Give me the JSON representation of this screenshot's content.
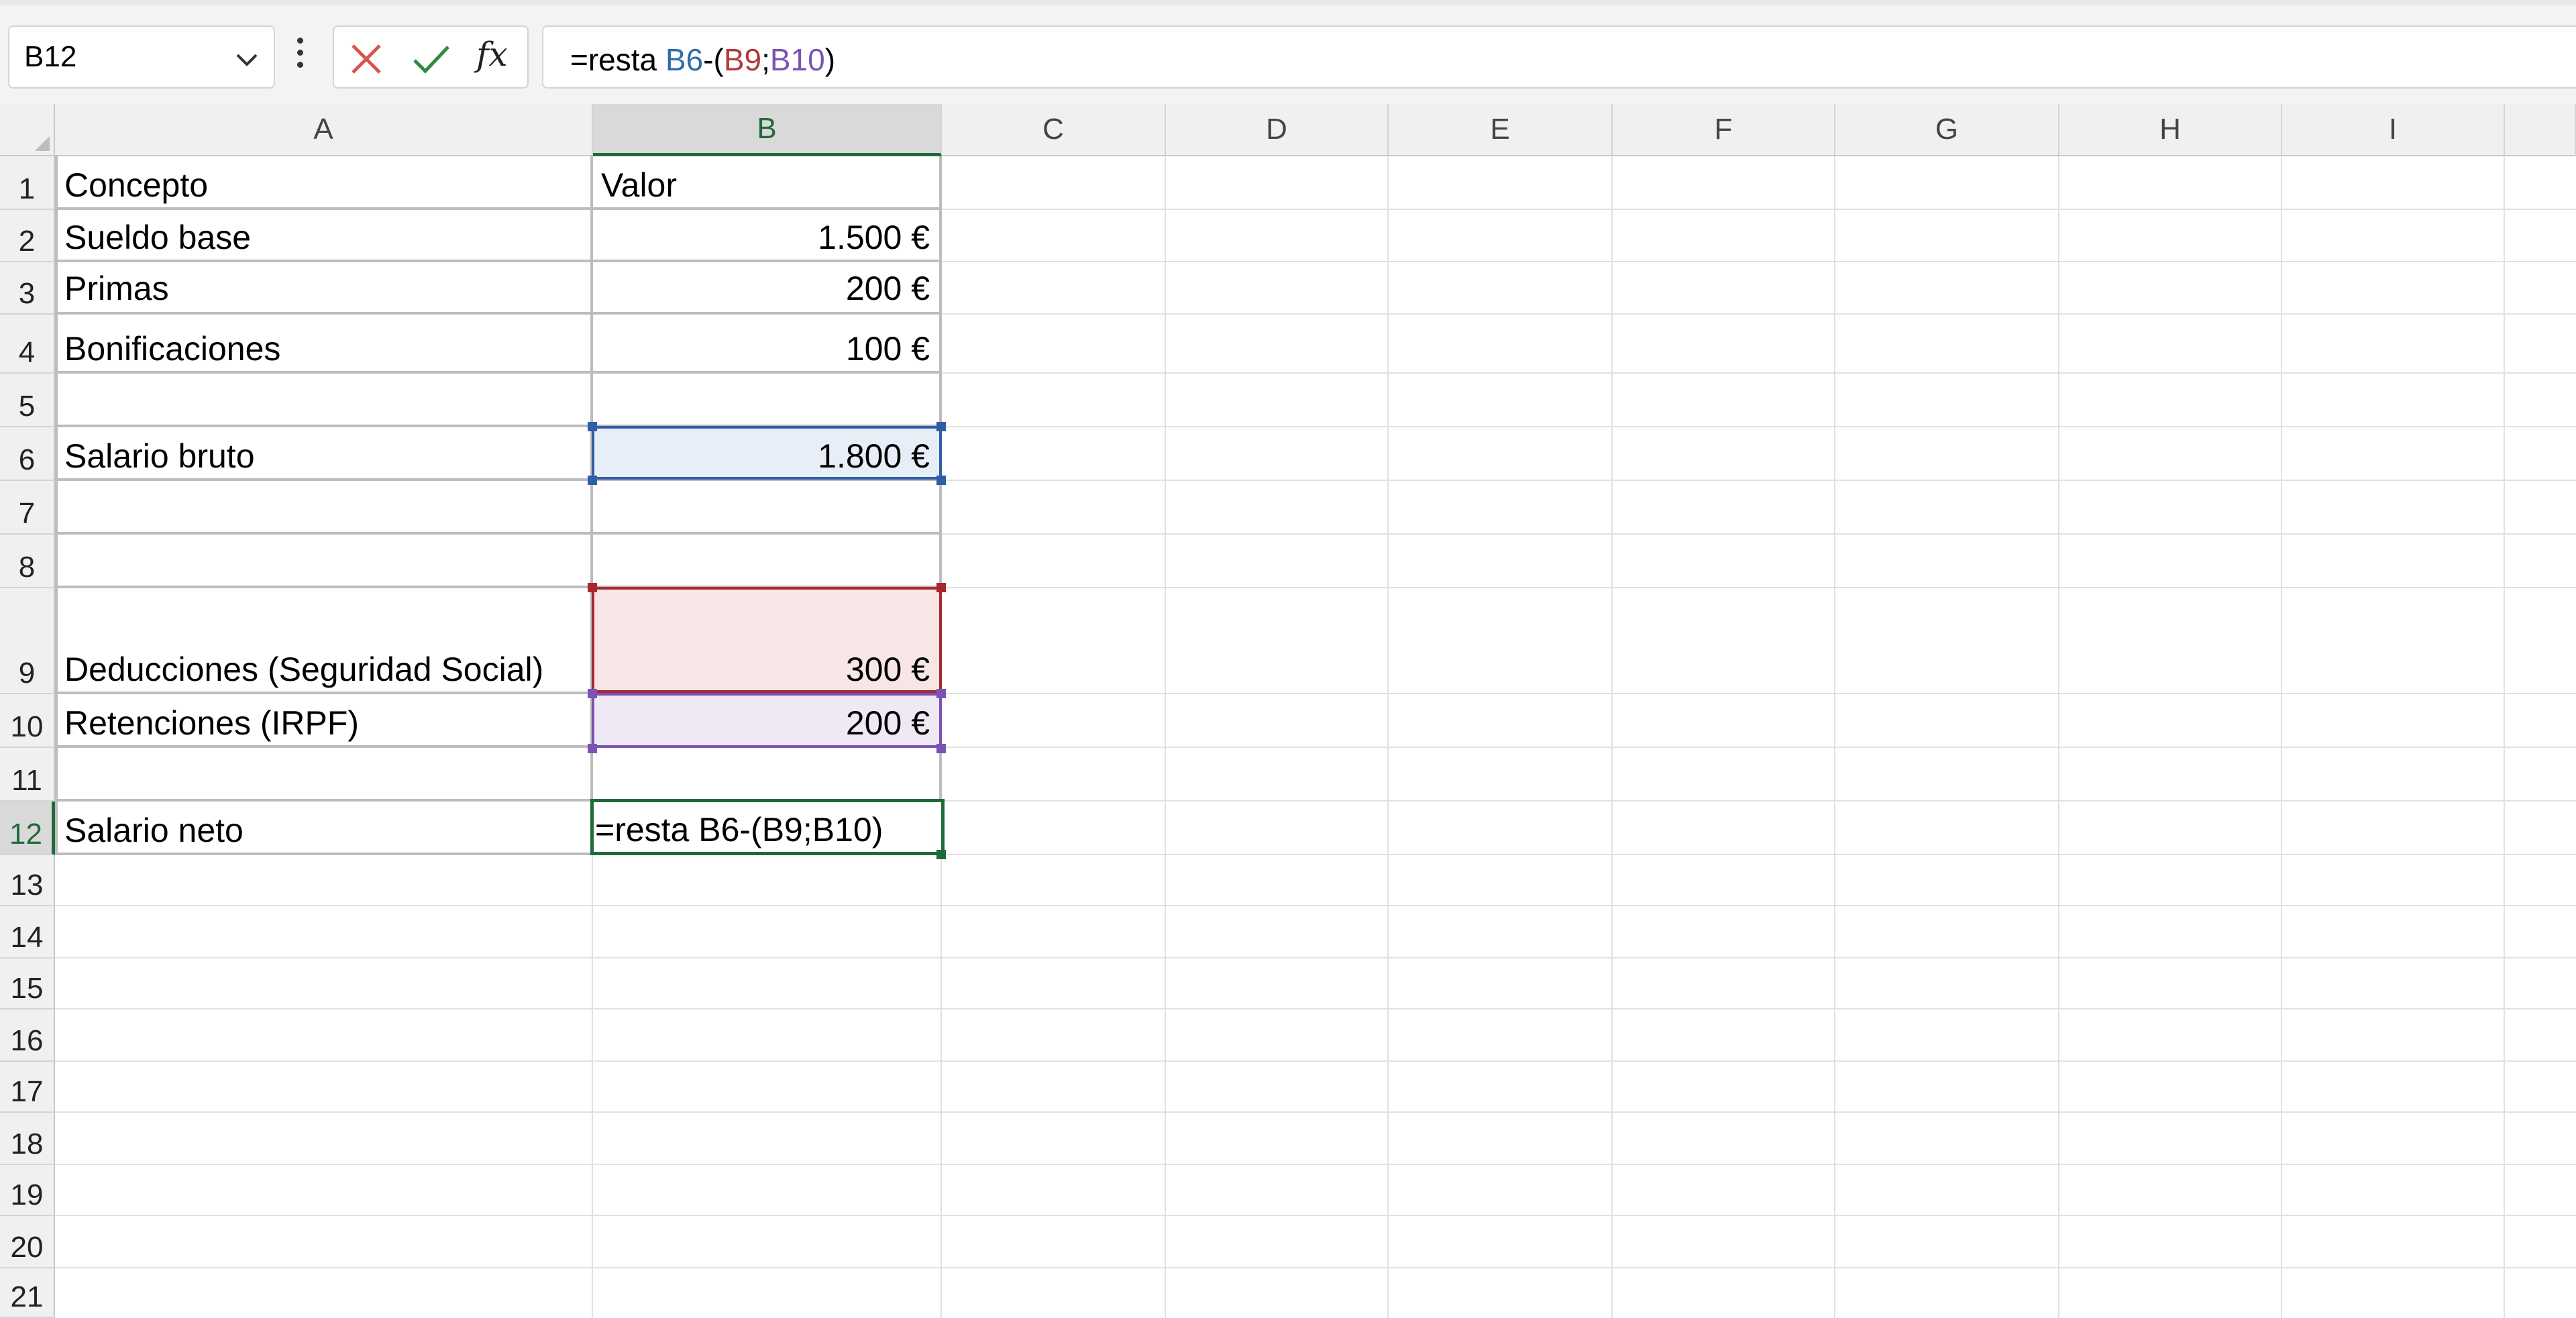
{
  "name_box": {
    "value": "B12"
  },
  "formula_bar": {
    "cancel_icon": "close-icon",
    "enter_icon": "checkmark-icon",
    "fx_label": "fx",
    "formula_parts": {
      "prefix": "=resta ",
      "ref1": "B6",
      "mid": "-(",
      "ref2": "B9",
      "sep": ";",
      "ref3": "B10",
      "suffix": ")"
    }
  },
  "columns": [
    "A",
    "B",
    "C",
    "D",
    "E",
    "F",
    "G",
    "H",
    "I"
  ],
  "selected_column": "B",
  "rows": [
    "1",
    "2",
    "3",
    "4",
    "5",
    "6",
    "7",
    "8",
    "9",
    "10",
    "11",
    "12",
    "13",
    "14",
    "15",
    "16",
    "17",
    "18",
    "19",
    "20",
    "21"
  ],
  "selected_row": "12",
  "cells": {
    "A1": "Concepto",
    "B1": "Valor",
    "A2": "Sueldo base",
    "B2": "1.500 €",
    "A3": "Primas",
    "B3": "200 €",
    "A4": "Bonificaciones",
    "B4": "100 €",
    "A6": "Salario bruto",
    "B6": "1.800 €",
    "A9": "Deducciones (Seguridad Social)",
    "B9": "300 €",
    "A10": "Retenciones (IRPF)",
    "B10": "200 €",
    "A12": "Salario neto",
    "B12": "=resta B6-(B9;B10)"
  },
  "colors": {
    "selection_green": "#1e6b3a",
    "ref_blue": "#2f5ea5",
    "ref_red": "#a8282e",
    "ref_purple": "#7a53b3"
  }
}
